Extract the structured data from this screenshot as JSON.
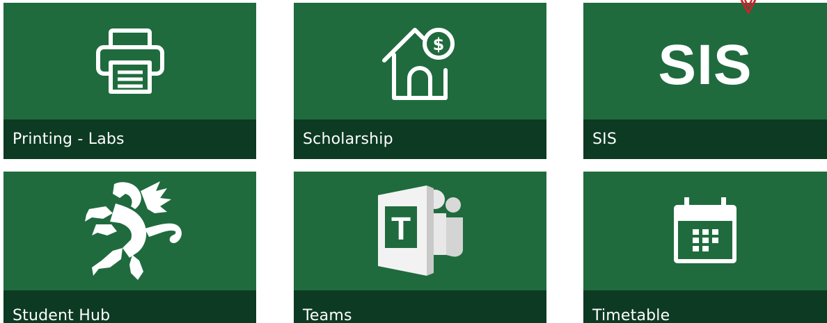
{
  "tiles": [
    {
      "label": "Printing - Labs",
      "icon": "printer-icon"
    },
    {
      "label": "Scholarship",
      "icon": "house-dollar-icon"
    },
    {
      "label": "SIS",
      "icon": "sis-text-icon",
      "icon_text": "SIS"
    },
    {
      "label": "Student Hub",
      "icon": "griffin-icon"
    },
    {
      "label": "Teams",
      "icon": "teams-icon"
    },
    {
      "label": "Timetable",
      "icon": "calendar-icon"
    }
  ],
  "colors": {
    "tile_bg": "#1f6b3e",
    "label_bar_bg": "#0d3a22",
    "label_text": "#ffffff",
    "arrow": "#d0202a"
  },
  "annotation": {
    "icon": "arrow-down-icon"
  }
}
